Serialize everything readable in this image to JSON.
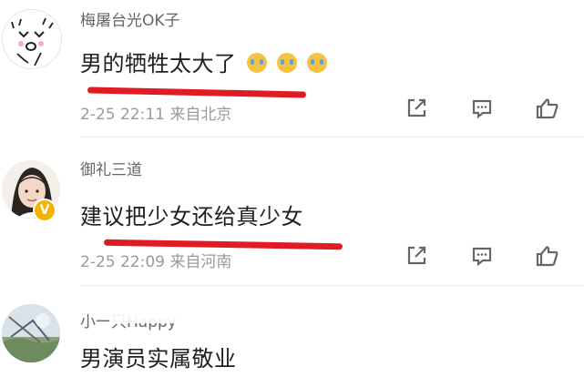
{
  "comments": [
    {
      "username": "梅屠台光OK子",
      "content": "男的牺牲太大了",
      "emojis": [
        "crying-emoji",
        "crying-emoji",
        "crying-emoji"
      ],
      "time": "2-25 22:11",
      "location": "来自北京",
      "verified": false,
      "underlined": true,
      "avatar": "doodle-face-avatar"
    },
    {
      "username": "御礼三道",
      "content": "建议把少女还给真少女",
      "emojis": [],
      "time": "2-25 22:09",
      "location": "来自河南",
      "verified": true,
      "underlined": true,
      "avatar": "portrait-avatar"
    },
    {
      "username": "小一只Happy",
      "content": "男演员实属敬业",
      "emojis": [],
      "time": "",
      "location": "",
      "verified": false,
      "underlined": false,
      "avatar": "landscape-avatar"
    }
  ],
  "actions": {
    "share": "share-icon",
    "comment": "comment-icon",
    "like": "like-icon"
  },
  "colors": {
    "underline": "#e11b23",
    "text": "#202020",
    "secondary": "#9a9a9a",
    "verified_badge": "#f3b400"
  }
}
